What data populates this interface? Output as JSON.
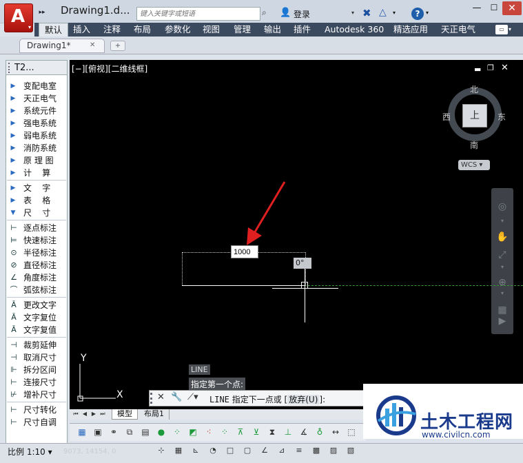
{
  "app": {
    "title": "Drawing1.d...",
    "search_placeholder": "键入关键字或短语",
    "login": "登录",
    "help": "?",
    "menu_dropdown": "▾"
  },
  "ribbon": {
    "tabs": [
      "默认",
      "插入",
      "注释",
      "布局",
      "参数化",
      "视图",
      "管理",
      "输出",
      "插件",
      "Autodesk 360",
      "精选应用",
      "天正电气"
    ]
  },
  "file_tabs": {
    "active": "Drawing1*"
  },
  "palette": {
    "title": "T2...",
    "items": [
      {
        "label": "变配电室",
        "type": "arrow"
      },
      {
        "label": "天正电气",
        "type": "arrow"
      },
      {
        "label": "系统元件",
        "type": "arrow"
      },
      {
        "label": "强电系统",
        "type": "arrow"
      },
      {
        "label": "弱电系统",
        "type": "arrow"
      },
      {
        "label": "消防系统",
        "type": "arrow"
      },
      {
        "label": "原 理 图",
        "type": "arrow"
      },
      {
        "label": "计    算",
        "type": "arrow"
      },
      {
        "label": "文    字",
        "type": "arrow"
      },
      {
        "label": "表    格",
        "type": "arrow"
      },
      {
        "label": "尺    寸",
        "type": "open"
      },
      {
        "label": "逐点标注",
        "type": "tool"
      },
      {
        "label": "快速标注",
        "type": "tool"
      },
      {
        "label": "半径标注",
        "type": "tool"
      },
      {
        "label": "直径标注",
        "type": "tool"
      },
      {
        "label": "角度标注",
        "type": "tool"
      },
      {
        "label": "弧弦标注",
        "type": "tool"
      },
      {
        "label": "更改文字",
        "type": "tool"
      },
      {
        "label": "文字复位",
        "type": "tool"
      },
      {
        "label": "文字复值",
        "type": "tool"
      },
      {
        "label": "裁剪延伸",
        "type": "tool"
      },
      {
        "label": "取消尺寸",
        "type": "tool"
      },
      {
        "label": "拆分区间",
        "type": "tool"
      },
      {
        "label": "连接尺寸",
        "type": "tool"
      },
      {
        "label": "增补尺寸",
        "type": "tool"
      },
      {
        "label": "尺寸转化",
        "type": "tool"
      },
      {
        "label": "尺寸自调",
        "type": "tool"
      }
    ]
  },
  "viewport": {
    "label": "[−][俯视][二维线框]",
    "viewcube": {
      "top": "上",
      "north": "北",
      "south": "南",
      "east": "东",
      "west": "西"
    },
    "wcs": "WCS",
    "dim_input": "1000",
    "angle": "0°"
  },
  "command": {
    "history": [
      "LINE",
      "指定第一个点:"
    ],
    "current_cmd": "LINE",
    "prompt": " 指定下一点或 ",
    "option_open": "[",
    "option": "放弃(U)",
    "option_close": "]:"
  },
  "layout_tabs": {
    "model": "模型",
    "layout1": "布局1"
  },
  "status": {
    "scale": "比例 1:10",
    "coords": "9073, 14154, 0"
  },
  "watermark": {
    "brand": "土木工程网",
    "url": "www.civilcn.com"
  },
  "colors": {
    "accent_red": "#d9261c",
    "ribbon_dark": "#3c4a60",
    "canvas": "#000000",
    "annotation_arrow": "#e02020"
  }
}
